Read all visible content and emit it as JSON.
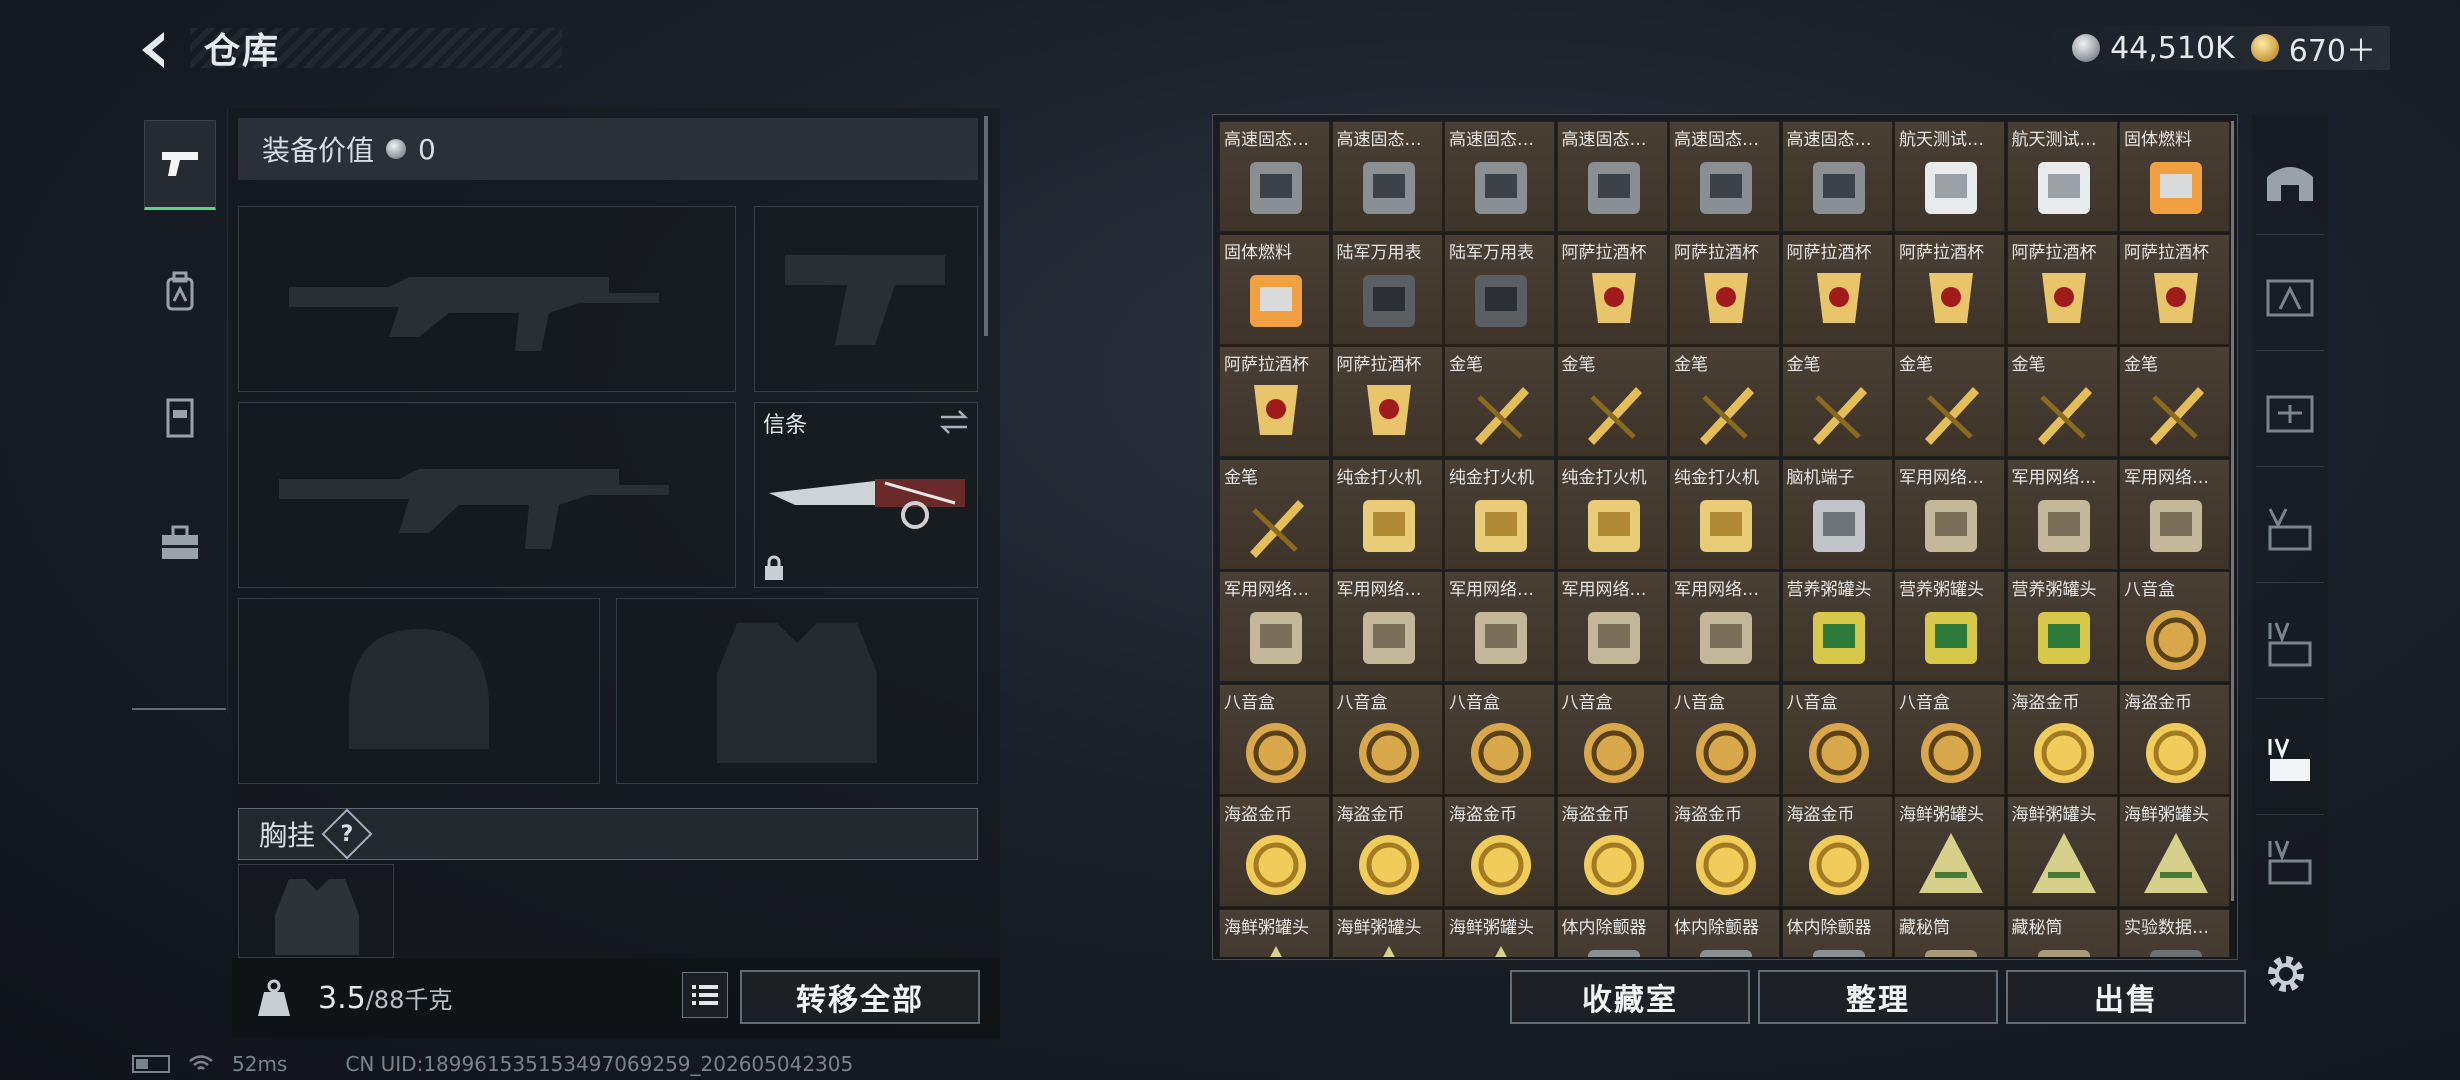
{
  "header": {
    "title": "仓库",
    "currency": [
      {
        "icon": "silver-coin-icon",
        "value": "44,510K"
      },
      {
        "icon": "gold-coin-icon",
        "value": "670＋"
      }
    ]
  },
  "rail": {
    "items": [
      {
        "icon": "pistol-icon",
        "active": true
      },
      {
        "icon": "backpack-icon",
        "active": false
      },
      {
        "icon": "vest-icon",
        "active": false
      },
      {
        "icon": "toolbox-icon",
        "active": false
      }
    ]
  },
  "equipment": {
    "value_label": "装备价值",
    "value": "0",
    "melee_label": "信条",
    "chest_label": "胸挂",
    "help": "?",
    "weight_current": "3.5",
    "weight_max": "/88千克",
    "transfer_all": "转移全部"
  },
  "storage": {
    "items": [
      "高速固态…",
      "高速固态…",
      "高速固态…",
      "高速固态…",
      "高速固态…",
      "高速固态…",
      "航天测试…",
      "航天测试…",
      "固体燃料",
      "固体燃料",
      "陆军万用表",
      "陆军万用表",
      "阿萨拉酒杯",
      "阿萨拉酒杯",
      "阿萨拉酒杯",
      "阿萨拉酒杯",
      "阿萨拉酒杯",
      "阿萨拉酒杯",
      "阿萨拉酒杯",
      "阿萨拉酒杯",
      "金笔",
      "金笔",
      "金笔",
      "金笔",
      "金笔",
      "金笔",
      "金笔",
      "金笔",
      "纯金打火机",
      "纯金打火机",
      "纯金打火机",
      "纯金打火机",
      "脑机端子",
      "军用网络…",
      "军用网络…",
      "军用网络…",
      "军用网络…",
      "军用网络…",
      "军用网络…",
      "军用网络…",
      "军用网络…",
      "营养粥罐头",
      "营养粥罐头",
      "营养粥罐头",
      "八音盒",
      "八音盒",
      "八音盒",
      "八音盒",
      "八音盒",
      "八音盒",
      "八音盒",
      "八音盒",
      "海盗金币",
      "海盗金币",
      "海盗金币",
      "海盗金币",
      "海盗金币",
      "海盗金币",
      "海盗金币",
      "海盗金币",
      "海鲜粥罐头",
      "海鲜粥罐头",
      "海鲜粥罐头",
      "海鲜粥罐头",
      "海鲜粥罐头",
      "海鲜粥罐头",
      "体内除颤器",
      "体内除颤器",
      "体内除颤器",
      "藏秘筒",
      "藏秘筒",
      "实验数据…"
    ],
    "buttons": {
      "collection": "收藏室",
      "organize": "整理",
      "sell": "出售"
    }
  },
  "side_tabs": [
    "bunker-icon",
    "gti-a-icon",
    "gti-b-icon",
    "v-icon",
    "iv-icon",
    "iv-active-icon",
    "iv-c-icon"
  ],
  "status": {
    "ping": "52ms",
    "uid": "CN UID:18996153515349706925​9_202605042305"
  }
}
